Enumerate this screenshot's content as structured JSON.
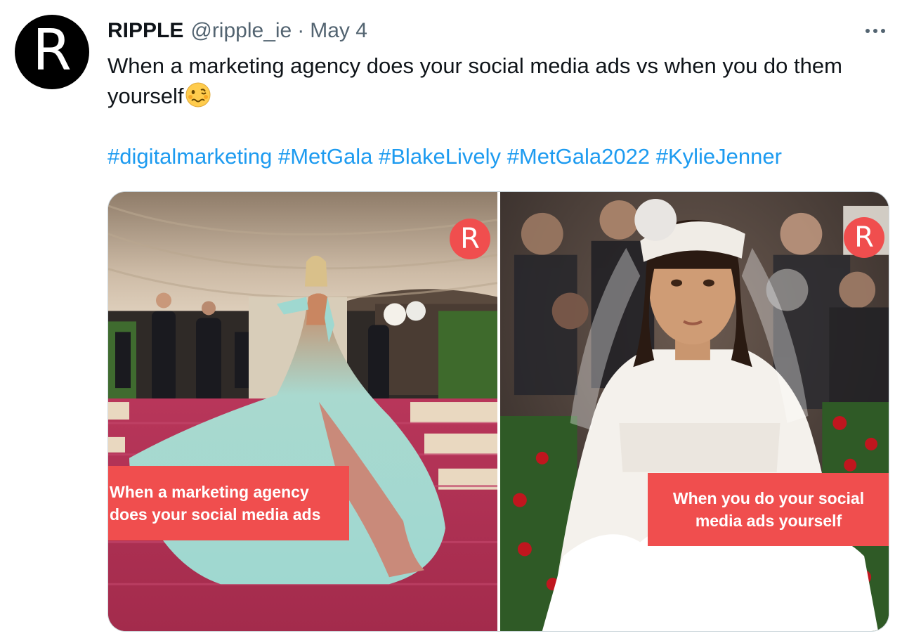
{
  "tweet": {
    "author": {
      "display_name": "RIPPLE",
      "handle": "@ripple_ie",
      "avatar_letter": "R"
    },
    "separator": "·",
    "timestamp": "May 4",
    "text": "When a marketing agency does your social media ads vs when you do them yourself",
    "emoji": "woozy-face",
    "hashtags": [
      "#digitalmarketing",
      "#MetGala",
      "#BlakeLively",
      "#MetGala2022",
      "#KylieJenner"
    ],
    "media": [
      {
        "badge_letter": "R",
        "caption_lines": [
          "When a marketing agency",
          "does your social media ads"
        ]
      },
      {
        "badge_letter": "R",
        "caption_lines": [
          "When you do your social",
          "media ads yourself"
        ]
      }
    ]
  },
  "colors": {
    "link": "#1d9bf0",
    "secondary_text": "#536471",
    "caption_bg": "#f04e4e",
    "avatar_bg": "#000000"
  },
  "icons": {
    "more": "more-horizontal-icon"
  }
}
